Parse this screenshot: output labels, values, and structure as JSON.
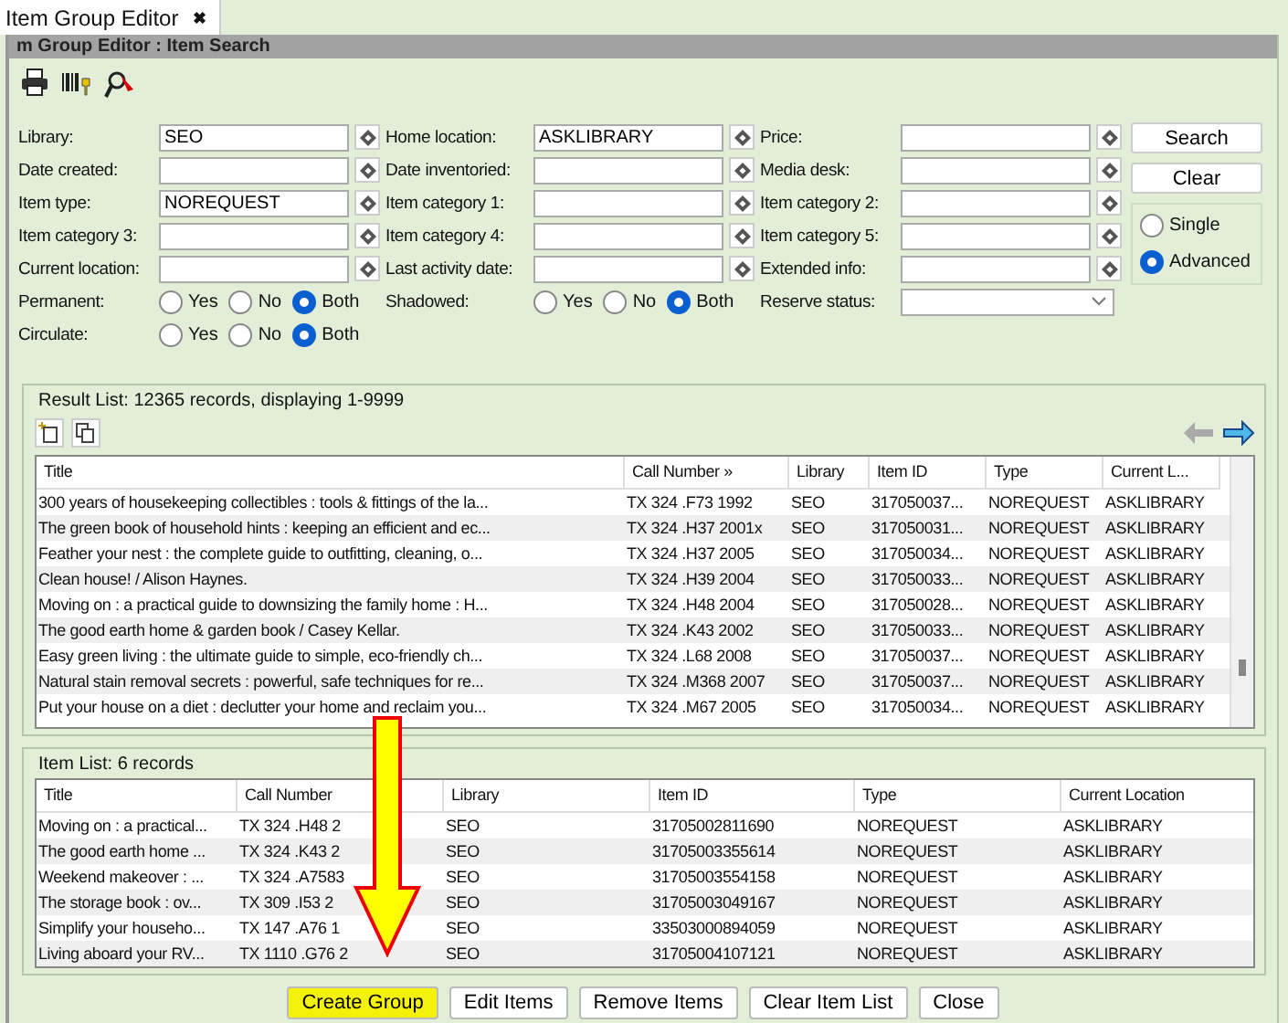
{
  "tabs": [
    {
      "label": "Item Group Editor",
      "selected": true,
      "close": "✖"
    }
  ],
  "header": {
    "title": "m Group Editor : Item Search"
  },
  "form": {
    "fields": [
      {
        "kind": "text",
        "label": "Library:",
        "value": "SEO"
      },
      {
        "kind": "text",
        "label": "Home location:",
        "value": "ASKLIBRARY"
      },
      {
        "kind": "text",
        "label": "Price:"
      },
      {
        "kind": "text",
        "label": "Date created:"
      },
      {
        "kind": "text",
        "label": "Date inventoried:"
      },
      {
        "kind": "text",
        "label": "Media desk:"
      },
      {
        "kind": "text",
        "label": "Item type:",
        "value": "NOREQUEST"
      },
      {
        "kind": "text",
        "label": "Item category 1:"
      },
      {
        "kind": "text",
        "label": "Item category 2:"
      },
      {
        "kind": "text",
        "label": "Item category 3:"
      },
      {
        "kind": "text",
        "label": "Item category 4:"
      },
      {
        "kind": "text",
        "label": "Item category 5:"
      },
      {
        "kind": "text",
        "label": "Current location:"
      },
      {
        "kind": "text",
        "label": "Last activity date:"
      },
      {
        "kind": "text",
        "label": "Extended info:"
      },
      {
        "kind": "radio",
        "label": "Permanent:",
        "options": [
          {
            "label": "Yes",
            "selected": false
          },
          {
            "label": "No",
            "selected": false
          },
          {
            "label": "Both",
            "selected": true
          }
        ]
      },
      {
        "kind": "radio",
        "label": "Shadowed:",
        "options": [
          {
            "label": "Yes",
            "selected": false
          },
          {
            "label": "No",
            "selected": false
          },
          {
            "label": "Both",
            "selected": true
          }
        ]
      },
      {
        "kind": "select",
        "label": "Reserve status:"
      },
      {
        "kind": "radio",
        "label": "Circulate:",
        "options": [
          {
            "label": "Yes",
            "selected": false
          },
          {
            "label": "No",
            "selected": false
          },
          {
            "label": "Both",
            "selected": true
          }
        ]
      }
    ],
    "buttons": [
      "Search",
      "Clear"
    ],
    "mode": [
      {
        "label": "Single",
        "selected": false
      },
      {
        "label": "Advanced",
        "selected": true
      }
    ]
  },
  "result_list": {
    "caption": "Result List: 12365 records, displaying 1-9999",
    "columns": [
      "Title",
      "Call Number »",
      "Library",
      "Item ID",
      "Type",
      "Current L..."
    ],
    "rows": [
      [
        "300 years of housekeeping collectibles : tools & fittings of the la...",
        "TX 324 .F73 1992",
        "SEO",
        "317050037...",
        "NOREQUEST",
        "ASKLIBRARY"
      ],
      [
        "The green book of household hints : keeping an efficient and ec...",
        "TX 324 .H37 2001x",
        "SEO",
        "317050031...",
        "NOREQUEST",
        "ASKLIBRARY"
      ],
      [
        "Feather your nest : the complete guide to outfitting, cleaning, o...",
        "TX 324 .H37 2005",
        "SEO",
        "317050034...",
        "NOREQUEST",
        "ASKLIBRARY"
      ],
      [
        "Clean house! / Alison Haynes.",
        "TX 324 .H39 2004",
        "SEO",
        "317050033...",
        "NOREQUEST",
        "ASKLIBRARY"
      ],
      [
        "Moving on : a practical guide to downsizing the family home : H...",
        "TX 324 .H48 2004",
        "SEO",
        "317050028...",
        "NOREQUEST",
        "ASKLIBRARY"
      ],
      [
        "The good earth home & garden book / Casey Kellar.",
        "TX 324 .K43 2002",
        "SEO",
        "317050033...",
        "NOREQUEST",
        "ASKLIBRARY"
      ],
      [
        "Easy green living : the ultimate guide to simple, eco-friendly ch...",
        "TX 324 .L68 2008",
        "SEO",
        "317050037...",
        "NOREQUEST",
        "ASKLIBRARY"
      ],
      [
        "Natural stain removal secrets : powerful, safe techniques for re...",
        "TX 324 .M368 2007",
        "SEO",
        "317050037...",
        "NOREQUEST",
        "ASKLIBRARY"
      ],
      [
        "Put your house on a diet : declutter your home and reclaim you...",
        "TX 324 .M67 2005",
        "SEO",
        "317050034...",
        "NOREQUEST",
        "ASKLIBRARY"
      ]
    ]
  },
  "item_list": {
    "caption": "Item List: 6 records",
    "columns": [
      "Title",
      "Call Number",
      "Library",
      "Item ID",
      "Type",
      "Current Location"
    ],
    "rows": [
      [
        "Moving on : a practical...",
        "TX 324 .H48 2",
        "SEO",
        "31705002811690",
        "NOREQUEST",
        "ASKLIBRARY"
      ],
      [
        "The good earth home ...",
        "TX 324 .K43 2",
        "SEO",
        "31705003355614",
        "NOREQUEST",
        "ASKLIBRARY"
      ],
      [
        "Weekend makeover : ...",
        "TX 324 .A7583",
        "SEO",
        "31705003554158",
        "NOREQUEST",
        "ASKLIBRARY"
      ],
      [
        "The storage book : ov...",
        "TX 309 .I53 2",
        "SEO",
        "31705003049167",
        "NOREQUEST",
        "ASKLIBRARY"
      ],
      [
        "Simplify your househo...",
        "TX 147 .A76 1",
        "SEO",
        "33503000894059",
        "NOREQUEST",
        "ASKLIBRARY"
      ],
      [
        "Living aboard your RV...",
        "TX 1110 .G76 2",
        "SEO",
        "31705004107121",
        "NOREQUEST",
        "ASKLIBRARY"
      ]
    ]
  },
  "actions": [
    {
      "label": "Create Group",
      "highlighted": true
    },
    {
      "label": "Edit Items",
      "highlighted": false
    },
    {
      "label": "Remove Items",
      "highlighted": false
    },
    {
      "label": "Clear Item List",
      "highlighted": false
    },
    {
      "label": "Close",
      "highlighted": false
    }
  ]
}
